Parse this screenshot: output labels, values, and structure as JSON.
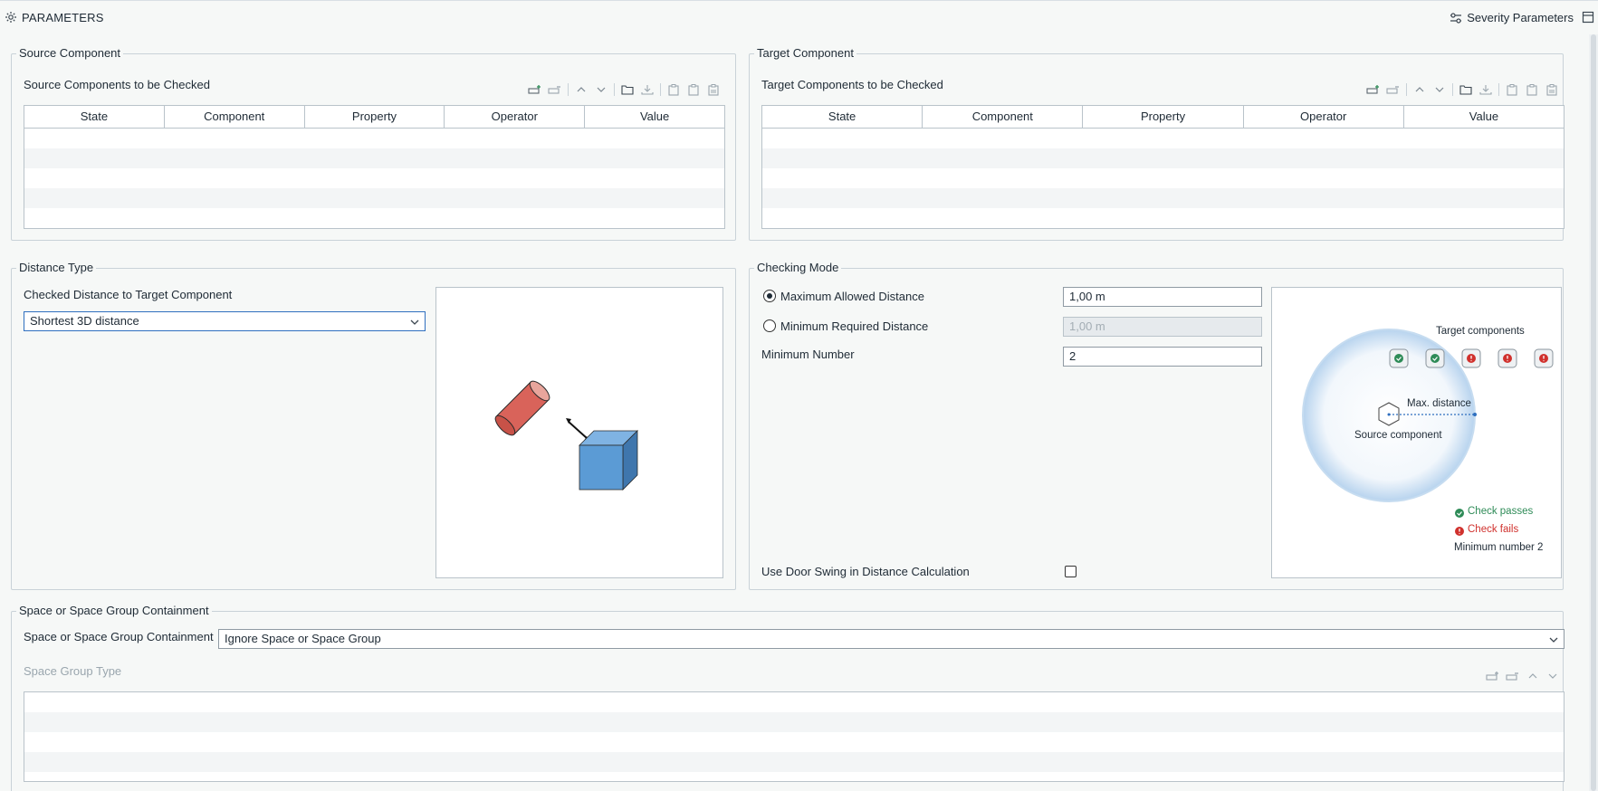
{
  "header": {
    "title": "PARAMETERS",
    "severity_label": "Severity Parameters"
  },
  "source": {
    "legend": "Source Component",
    "heading": "Source Components to be Checked",
    "columns": [
      "State",
      "Component",
      "Property",
      "Operator",
      "Value"
    ]
  },
  "target": {
    "legend": "Target Component",
    "heading": "Target Components to be Checked",
    "columns": [
      "State",
      "Component",
      "Property",
      "Operator",
      "Value"
    ]
  },
  "distance": {
    "legend": "Distance Type",
    "label": "Checked Distance to Target Component",
    "selected": "Shortest 3D distance"
  },
  "checking": {
    "legend": "Checking Mode",
    "max_label": "Maximum Allowed Distance",
    "max_value": "1,00 m",
    "max_selected": true,
    "min_label": "Minimum Required Distance",
    "min_value": "1,00 m",
    "min_number_label": "Minimum Number",
    "min_number_value": "2",
    "door_swing_label": "Use Door Swing in Distance Calculation",
    "door_swing_checked": false,
    "diagram": {
      "target_components": "Target components",
      "max_distance": "Max. distance",
      "source_component": "Source component",
      "check_passes": "Check passes",
      "check_fails": "Check fails",
      "minimum_number": "Minimum number 2"
    }
  },
  "space": {
    "legend": "Space or Space Group Containment",
    "label": "Space or Space Group Containment",
    "selected": "Ignore Space or Space Group",
    "group_type_label": "Space Group Type"
  },
  "colors": {
    "accent": "#2f6fbf",
    "pass": "#2e8b57",
    "fail": "#d0312d",
    "cylinder": "#d9635a",
    "cube": "#5b9bd5"
  }
}
